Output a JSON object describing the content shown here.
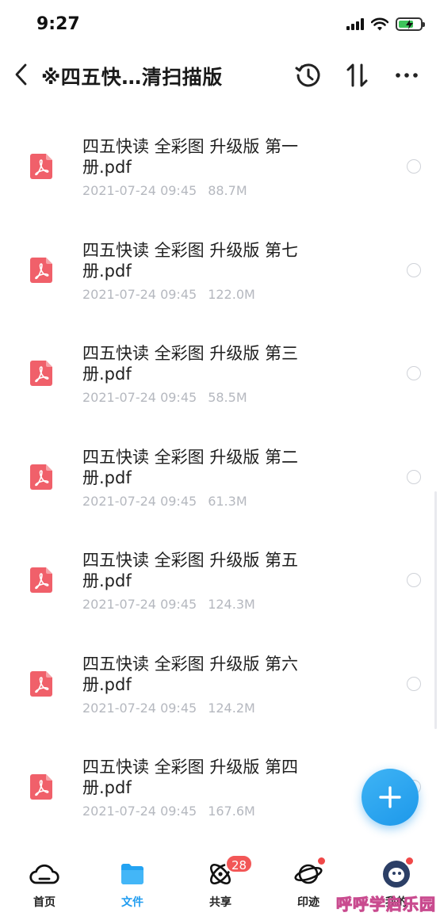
{
  "status_bar": {
    "time": "9:27"
  },
  "nav": {
    "title": "※四五快…清扫描版"
  },
  "files": [
    {
      "name": "四五快读 全彩图 升级版 第一册.pdf",
      "date": "2021-07-24 09:45",
      "size": "88.7M"
    },
    {
      "name": "四五快读 全彩图 升级版 第七册.pdf",
      "date": "2021-07-24 09:45",
      "size": "122.0M"
    },
    {
      "name": "四五快读 全彩图 升级版 第三册.pdf",
      "date": "2021-07-24 09:45",
      "size": "58.5M"
    },
    {
      "name": "四五快读 全彩图 升级版 第二册.pdf",
      "date": "2021-07-24 09:45",
      "size": "61.3M"
    },
    {
      "name": "四五快读 全彩图 升级版 第五册.pdf",
      "date": "2021-07-24 09:45",
      "size": "124.3M"
    },
    {
      "name": "四五快读 全彩图 升级版 第六册.pdf",
      "date": "2021-07-24 09:45",
      "size": "124.2M"
    },
    {
      "name": "四五快读 全彩图 升级版 第四册.pdf",
      "date": "2021-07-24 09:45",
      "size": "167.6M"
    }
  ],
  "tabs": [
    {
      "label": "首页",
      "icon": "cloud-icon"
    },
    {
      "label": "文件",
      "icon": "folder-icon",
      "active": true
    },
    {
      "label": "共享",
      "icon": "atom-icon",
      "badge": "28"
    },
    {
      "label": "印迹",
      "icon": "planet-icon",
      "dot": true
    },
    {
      "label": "我的",
      "icon": "avatar",
      "dot": true
    }
  ],
  "watermark": "呼呼学启乐园",
  "colors": {
    "accent": "#1f9cf0",
    "pdf": "#f0606a",
    "badge": "#f25757",
    "meta": "#b5b8bf"
  }
}
